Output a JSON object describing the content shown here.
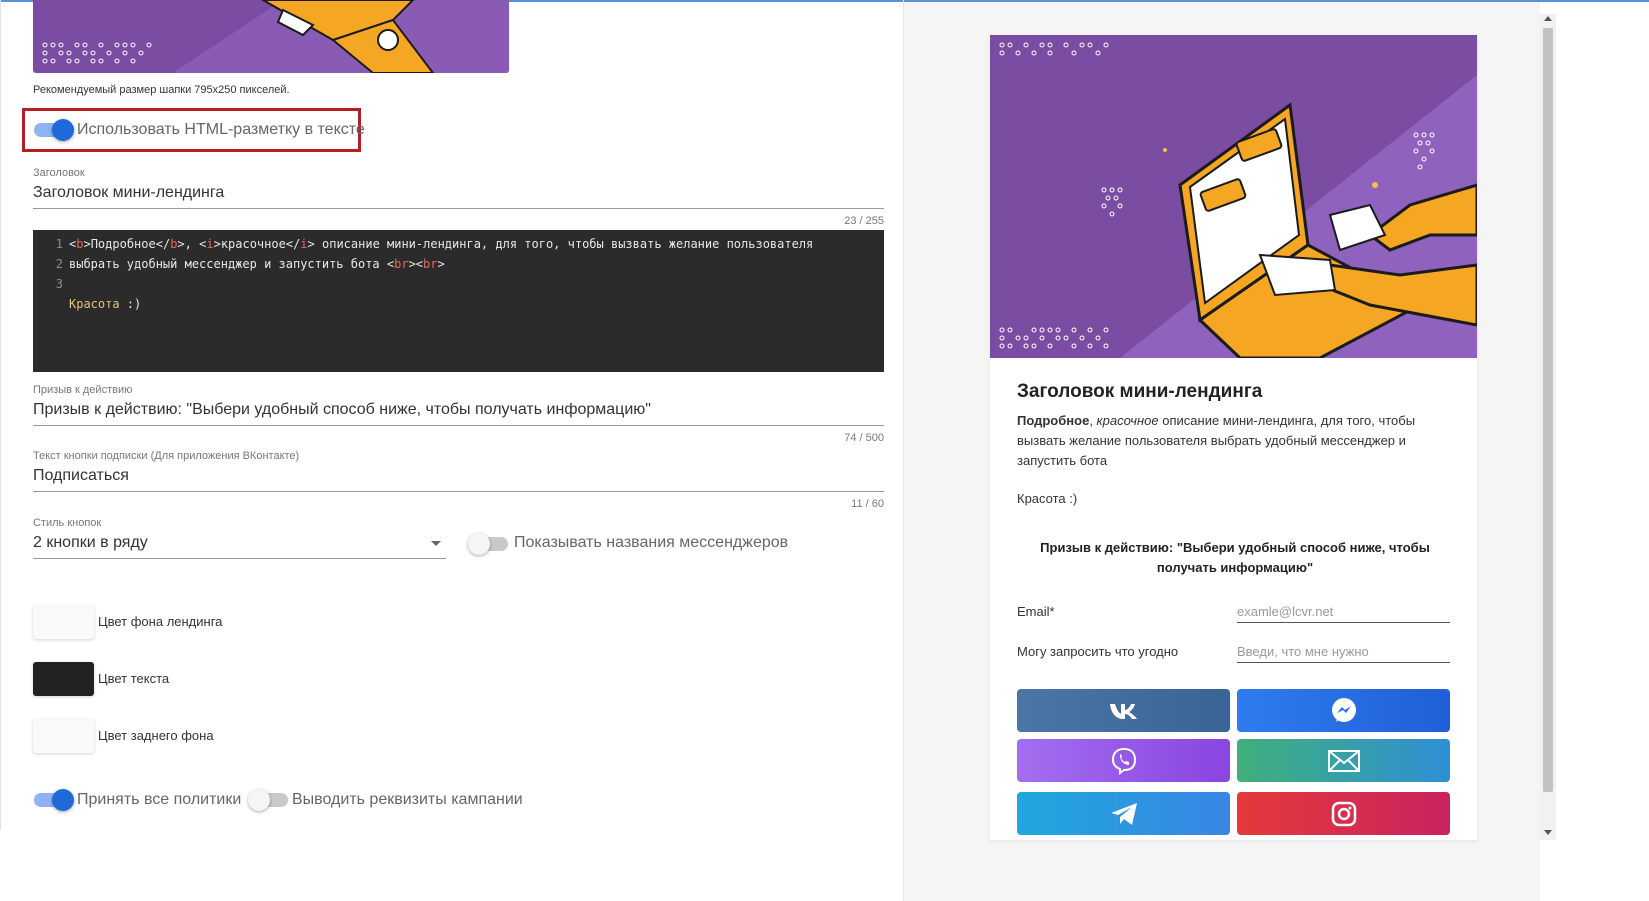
{
  "header": {
    "hint": "Рекомендуемый размер шапки 795x250 пикселей."
  },
  "settings": {
    "use_html_label": "Использовать HTML-разметку в тексте",
    "use_html_on": true,
    "title_caption": "Заголовок",
    "title_value": "Заголовок мини-лендинга",
    "title_counter": "23 / 255",
    "code_lines": [
      {
        "n": "1"
      },
      {
        "n": "2"
      },
      {
        "n": "3"
      }
    ],
    "code_text": {
      "l1_t1": "Подробное",
      "l1_t2": ", ",
      "l1_t3": "красочное",
      "l1_t4": " описание мини-лендинга, для того, чтобы вызвать желание пользователя",
      "l2_t1": "выбрать удобный мессенджер и запустить бота ",
      "l3": "Красота",
      "l3_rest": " :)"
    },
    "cta_caption": "Призыв к действию",
    "cta_value": "Призыв к действию: \"Выбери удобный способ ниже, чтобы получать информацию\"",
    "cta_counter": "74 / 500",
    "sub_caption": "Текст кнопки подписки (Для приложения ВКонтакте)",
    "sub_value": "Подписаться",
    "sub_counter": "11 / 60",
    "style_caption": "Стиль кнопок",
    "style_value": "2 кнопки в ряду",
    "show_names_label": "Показывать названия мессенджеров",
    "show_names_on": false,
    "colors": [
      {
        "label": "Цвет фона лендинга",
        "hex": "#fafafa"
      },
      {
        "label": "Цвет текста",
        "hex": "#222222"
      },
      {
        "label": "Цвет заднего фона",
        "hex": "#fafafa"
      }
    ],
    "accept_label": "Принять все политики",
    "accept_on": true,
    "requisites_label": "Выводить реквизиты кампании",
    "requisites_on": false
  },
  "preview": {
    "title": "Заголовок мини-лендинга",
    "desc_bold": "Подробное",
    "desc_sep": ", ",
    "desc_italic": "красочное",
    "desc_rest": " описание мини-лендинга, для того, чтобы вызвать желание пользователя выбрать удобный мессенджер и запустить бота",
    "extra": "Красота :)",
    "cta": "Призыв к действию: \"Выбери удобный способ ниже, чтобы получать информацию\"",
    "email_label": "Email*",
    "email_placeholder": "examle@lcvr.net",
    "ask_label": "Могу запросить что угодно",
    "ask_placeholder": "Введи, что мне нужно",
    "buttons": [
      {
        "icon": "vk-icon",
        "name": "vk-button"
      },
      {
        "icon": "messenger-icon",
        "name": "messenger-button"
      },
      {
        "icon": "viber-icon",
        "name": "viber-button"
      },
      {
        "icon": "mail-icon",
        "name": "email-button"
      },
      {
        "icon": "telegram-icon",
        "name": "telegram-button"
      },
      {
        "icon": "instagram-icon",
        "name": "instagram-button"
      }
    ]
  },
  "colors": {
    "accent": "#1e6ad8",
    "highlight_border": "#b21f24",
    "banner_purple": "#7b4da2",
    "banner_orange": "#f5a623"
  }
}
